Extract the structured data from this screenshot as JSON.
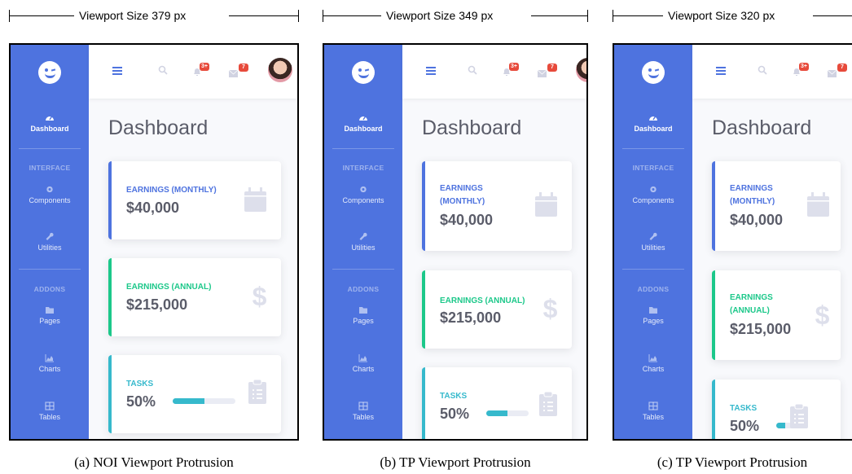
{
  "colors": {
    "sidebar": "#4e73df",
    "primary": "#4e73df",
    "success": "#1cc88a",
    "info": "#36b9cc",
    "danger": "#e74a3b",
    "icon_gray": "#dddfeb"
  },
  "icons": {
    "brand": "laugh-wink-icon",
    "dashboard": "tachometer-icon",
    "components": "cog-icon",
    "utilities": "wrench-icon",
    "pages": "folder-icon",
    "charts": "chart-area-icon",
    "tables": "table-icon",
    "topbar": [
      "bars-icon",
      "search-icon",
      "bell-icon",
      "envelope-icon"
    ],
    "cards": [
      "calendar-icon",
      "dollar-icon",
      "clipboard-list-icon"
    ]
  },
  "panels": [
    {
      "ruler_label": "Viewport Size 379 px",
      "caption": "(a) NOI Viewport Protrusion",
      "app": {
        "nav": {
          "dashboard": "Dashboard",
          "heading_interface": "INTERFACE",
          "components": "Components",
          "utilities": "Utilities",
          "heading_addons": "ADDONS",
          "pages": "Pages",
          "charts": "Charts",
          "tables": "Tables"
        },
        "topbar": {
          "alerts_badge": "3+",
          "messages_badge": "7"
        },
        "title": "Dashboard",
        "cards": [
          {
            "label_lines": [
              "EARNINGS (MONTHLY)"
            ],
            "value": "$40,000"
          },
          {
            "label_lines": [
              "EARNINGS (ANNUAL)"
            ],
            "value": "$215,000"
          },
          {
            "label_lines": [
              "TASKS"
            ],
            "value": "50%",
            "progress": 0.5
          }
        ]
      }
    },
    {
      "ruler_label": "Viewport Size 349 px",
      "caption": "(b) TP Viewport Protrusion",
      "app": {
        "nav": {
          "dashboard": "Dashboard",
          "heading_interface": "INTERFACE",
          "components": "Components",
          "utilities": "Utilities",
          "heading_addons": "ADDONS",
          "pages": "Pages",
          "charts": "Charts",
          "tables": "Tables"
        },
        "topbar": {
          "alerts_badge": "3+",
          "messages_badge": "7"
        },
        "title": "Dashboard",
        "cards": [
          {
            "label_lines": [
              "EARNINGS",
              "(MONTHLY)"
            ],
            "value": "$40,000"
          },
          {
            "label_lines": [
              "EARNINGS (ANNUAL)"
            ],
            "value": "$215,000"
          },
          {
            "label_lines": [
              "TASKS"
            ],
            "value": "50%",
            "progress": 0.5
          }
        ]
      }
    },
    {
      "ruler_label": "Viewport Size 320 px",
      "caption": "(c) TP Viewport Protrusion",
      "app": {
        "nav": {
          "dashboard": "Dashboard",
          "heading_interface": "INTERFACE",
          "components": "Components",
          "utilities": "Utilities",
          "heading_addons": "ADDONS",
          "pages": "Pages",
          "charts": "Charts",
          "tables": "Tables"
        },
        "topbar": {
          "alerts_badge": "3+",
          "messages_badge": "7"
        },
        "title": "Dashboard",
        "cards": [
          {
            "label_lines": [
              "EARNINGS",
              "(MONTHLY)"
            ],
            "value": "$40,000"
          },
          {
            "label_lines": [
              "EARNINGS",
              "(ANNUAL)"
            ],
            "value": "$215,000"
          },
          {
            "label_lines": [
              "TASKS"
            ],
            "value": "50%",
            "progress": 0.5
          }
        ]
      }
    }
  ]
}
